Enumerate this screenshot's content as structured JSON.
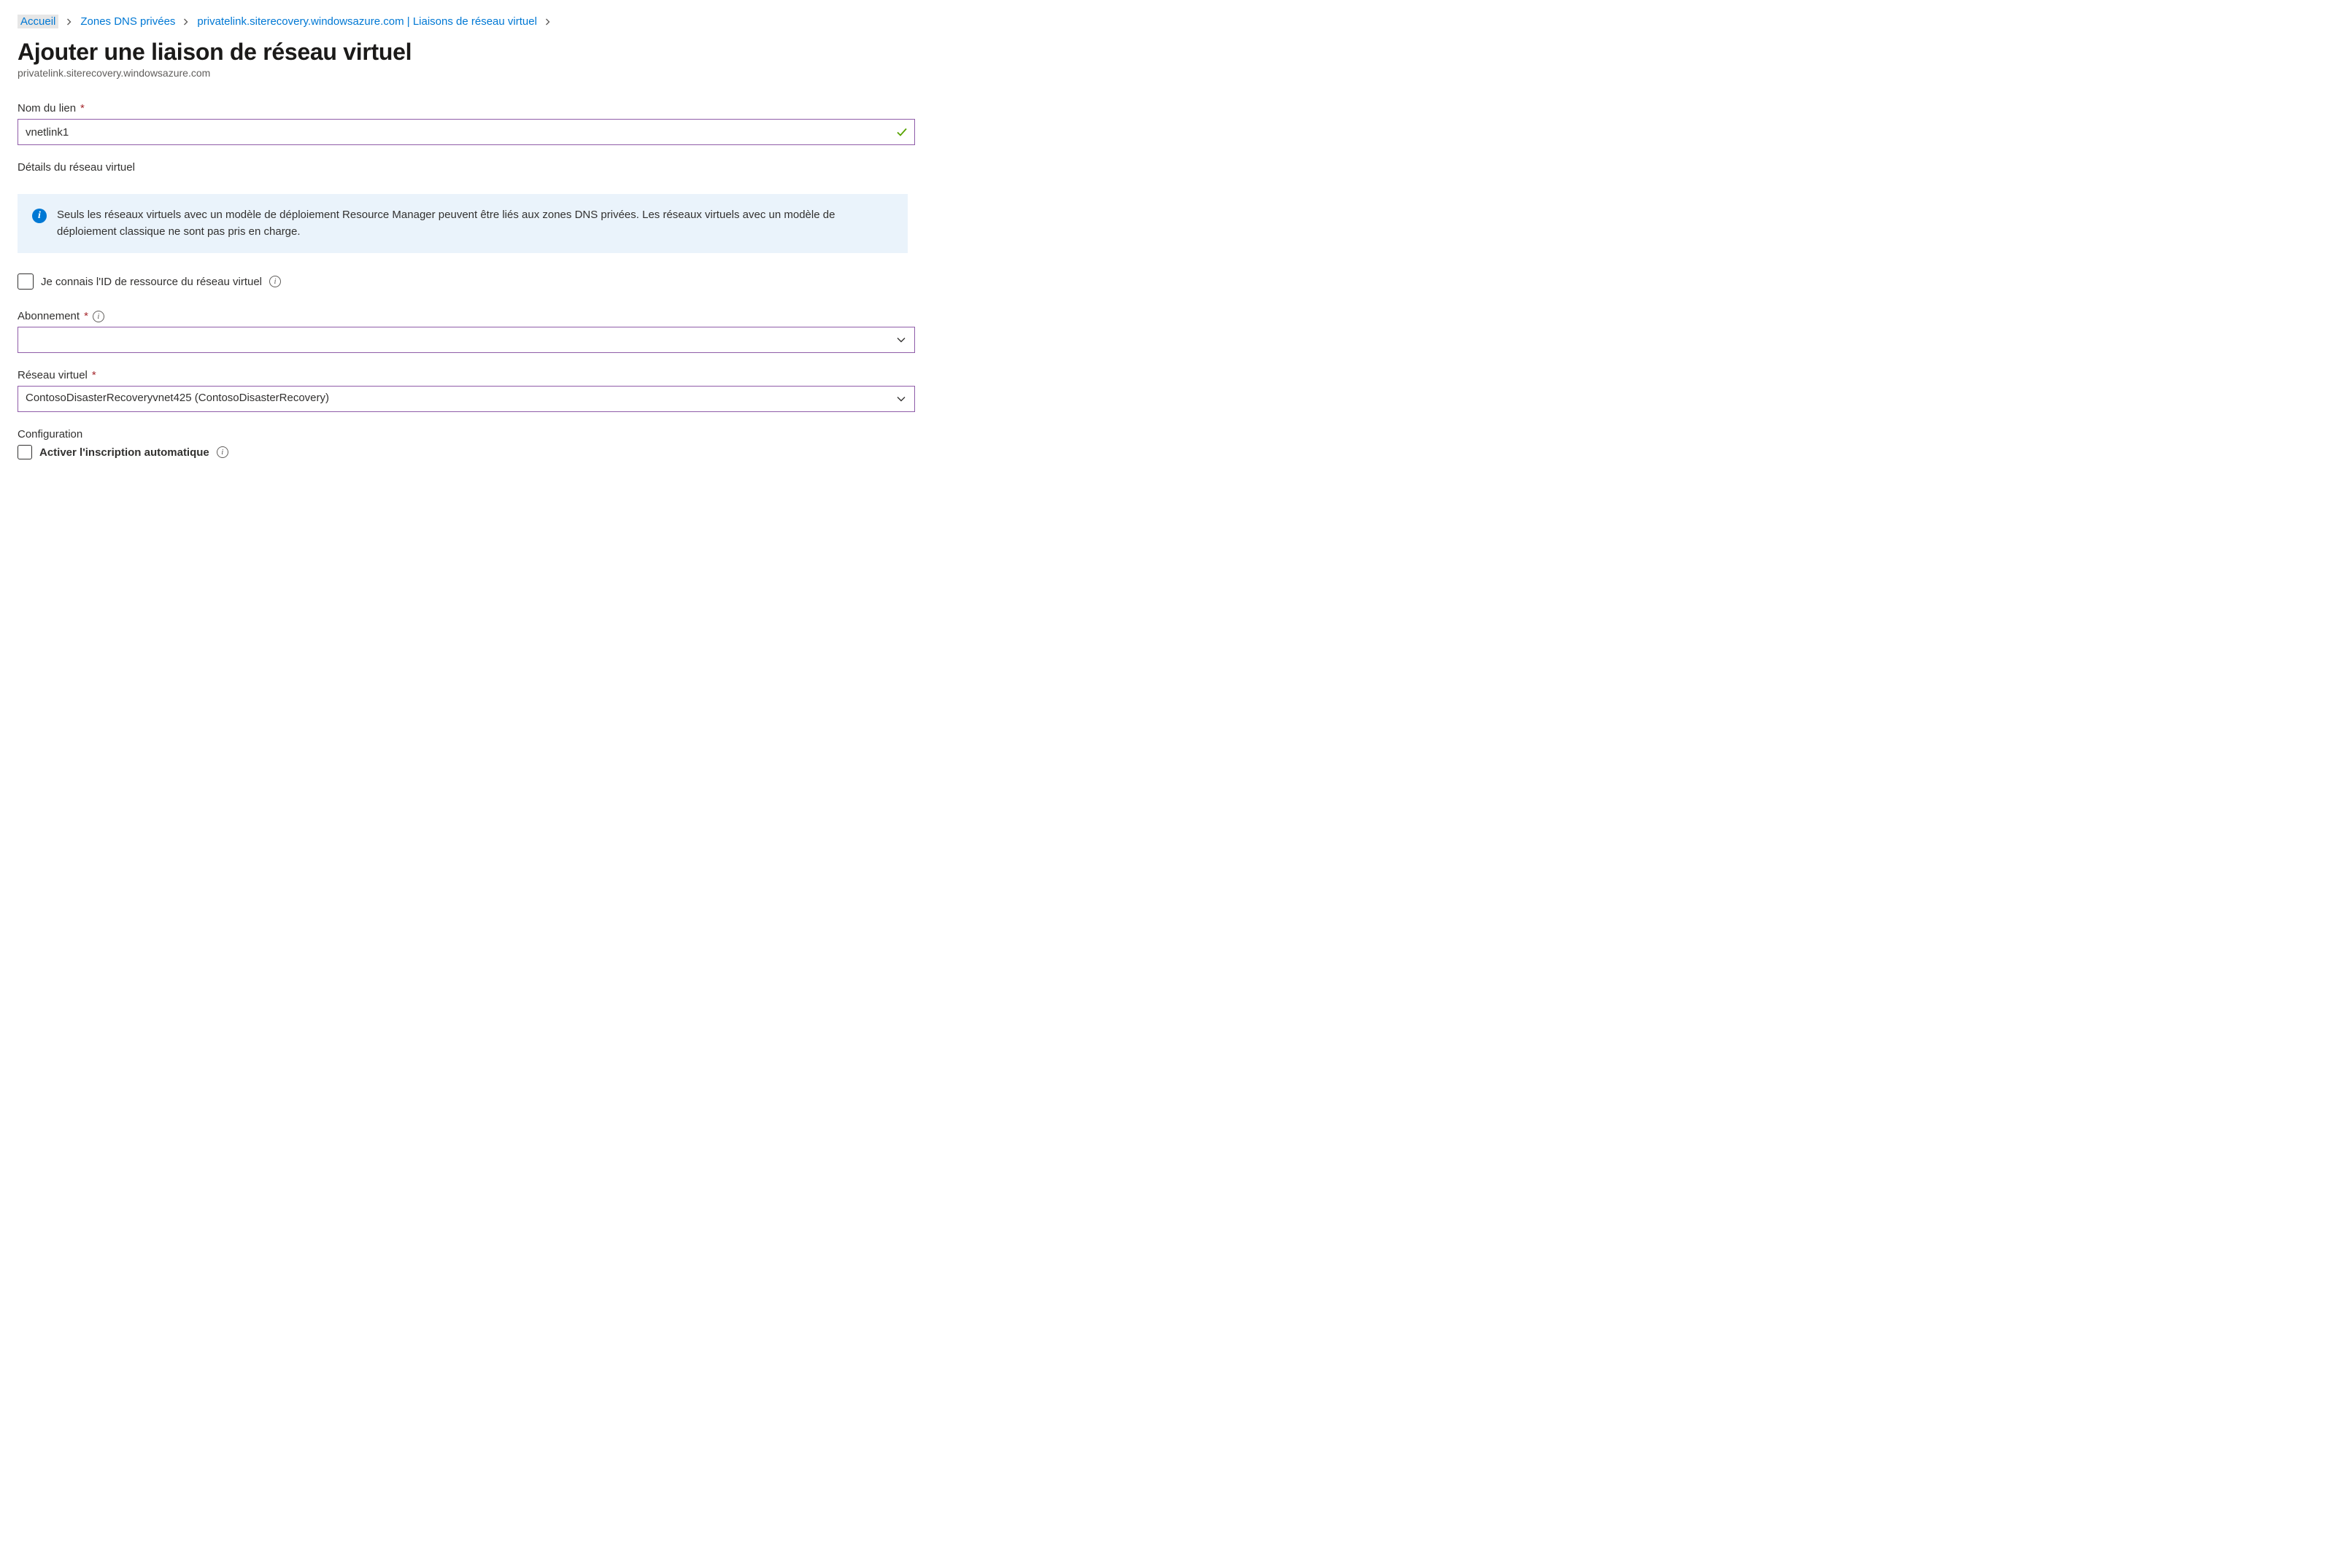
{
  "breadcrumb": {
    "items": [
      {
        "label": "Accueil"
      },
      {
        "label": "Zones DNS privées"
      },
      {
        "label": "privatelink.siterecovery.windowsazure.com | Liaisons de réseau virtuel"
      }
    ]
  },
  "header": {
    "title": "Ajouter une liaison de réseau virtuel",
    "subtitle": "privatelink.siterecovery.windowsazure.com"
  },
  "form": {
    "linkName": {
      "label": "Nom du lien",
      "value": "vnetlink1"
    },
    "vnetDetails": {
      "heading": "Détails du réseau virtuel",
      "info": "Seuls les réseaux virtuels avec un modèle de déploiement Resource Manager peuvent être liés aux zones DNS privées. Les réseaux virtuels avec un modèle de déploiement classique ne sont pas pris en charge."
    },
    "knowResourceId": {
      "label": "Je connais l'ID de ressource du réseau virtuel"
    },
    "subscription": {
      "label": "Abonnement",
      "value": ""
    },
    "virtualNetwork": {
      "label": "Réseau virtuel",
      "value": "ContosoDisasterRecoveryvnet425 (ContosoDisasterRecovery)"
    },
    "configuration": {
      "heading": "Configuration",
      "autoRegistration": {
        "label": "Activer l'inscription automatique"
      }
    }
  }
}
